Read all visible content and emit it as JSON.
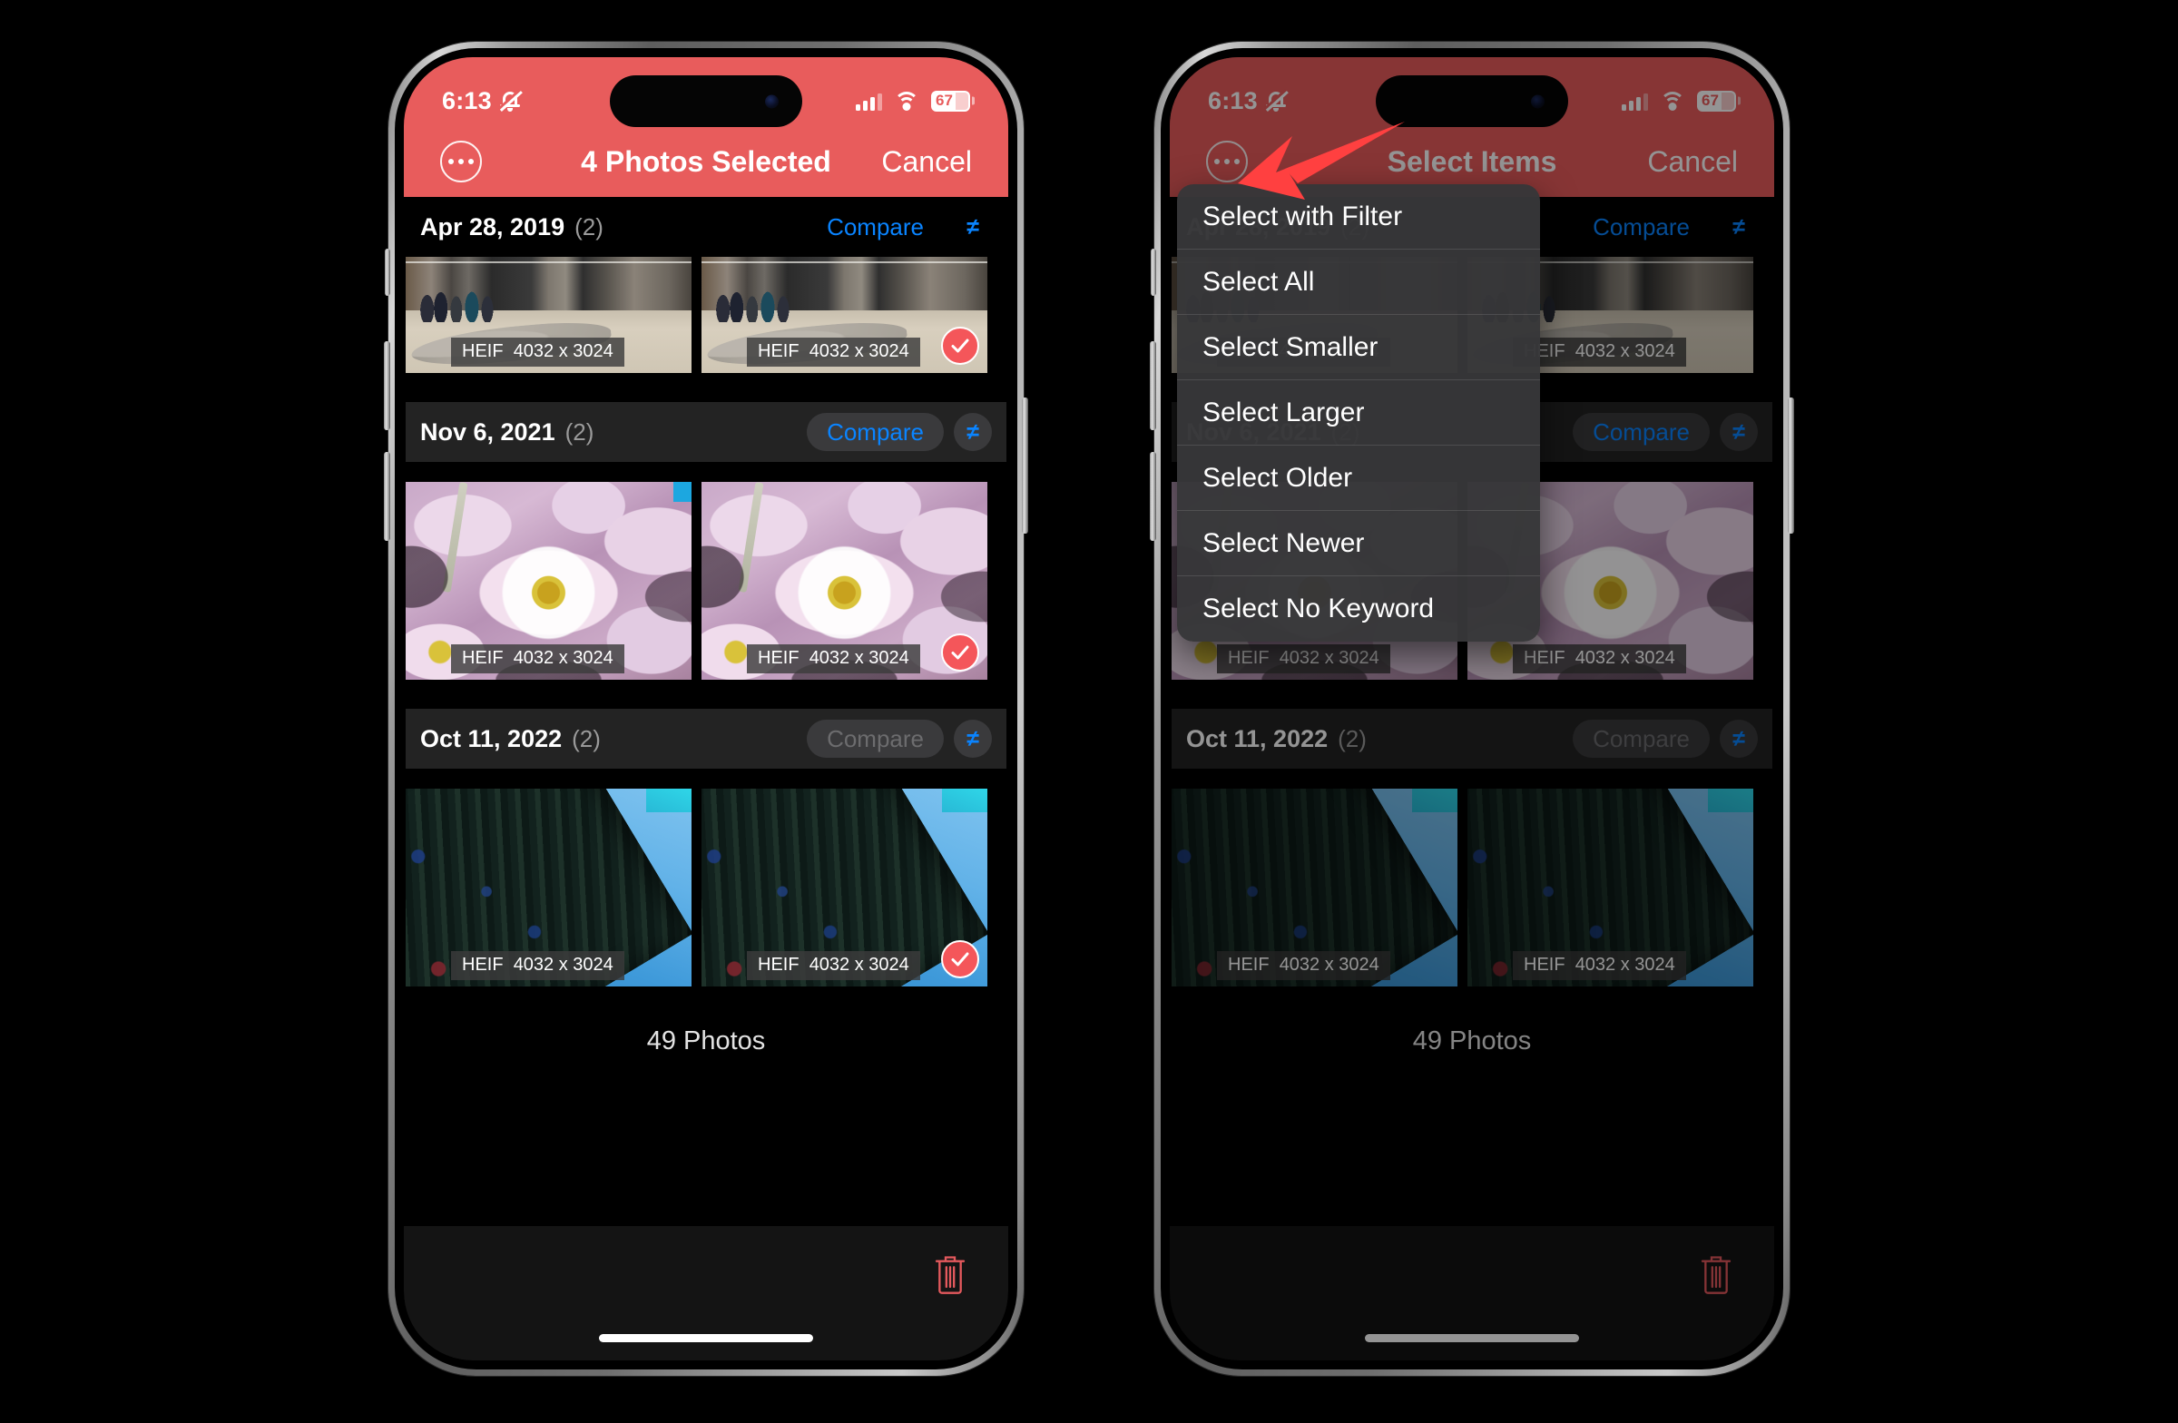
{
  "app": {
    "status_bar": {
      "time": "6:13",
      "silent_icon": "bell-slash-icon",
      "cellular_icon": "cellular-signal-icon",
      "wifi_icon": "wifi-icon",
      "battery_level": "67"
    },
    "accent_color": "#e85c5c",
    "link_color": "#0a84ff",
    "selection_color": "#ff6b6b",
    "delete_color": "#e4595d"
  },
  "phone_left": {
    "nav": {
      "more_icon": "ellipsis-icon",
      "title": "4 Photos Selected",
      "cancel_label": "Cancel"
    },
    "groups": [
      {
        "date": "Apr 28, 2019",
        "count": "(2)",
        "compare_label": "Compare",
        "not_equal_label": "≠",
        "compare_enabled": true,
        "photos": [
          {
            "format": "HEIF",
            "dimensions": "4032 x 3024",
            "selected": false,
            "art": "street"
          },
          {
            "format": "HEIF",
            "dimensions": "4032 x 3024",
            "selected": true,
            "art": "street"
          }
        ]
      },
      {
        "date": "Nov 6, 2021",
        "count": "(2)",
        "compare_label": "Compare",
        "not_equal_label": "≠",
        "compare_enabled": true,
        "photos": [
          {
            "format": "HEIF",
            "dimensions": "4032 x 3024",
            "selected": false,
            "art": "flower"
          },
          {
            "format": "HEIF",
            "dimensions": "4032 x 3024",
            "selected": true,
            "art": "flower"
          }
        ]
      },
      {
        "date": "Oct 11, 2022",
        "count": "(2)",
        "compare_label": "Compare",
        "not_equal_label": "≠",
        "compare_enabled": false,
        "photos": [
          {
            "format": "HEIF",
            "dimensions": "4032 x 3024",
            "selected": false,
            "art": "tower"
          },
          {
            "format": "HEIF",
            "dimensions": "4032 x 3024",
            "selected": true,
            "art": "tower"
          }
        ]
      }
    ],
    "footer": {
      "photo_count": "49 Photos",
      "delete_icon": "trash-icon"
    }
  },
  "phone_right": {
    "nav": {
      "more_icon": "ellipsis-icon",
      "title": "Select Items",
      "cancel_label": "Cancel"
    },
    "menu": {
      "items": [
        {
          "label": "Select with Filter"
        },
        {
          "label": "Select All"
        },
        {
          "label": "Select Smaller"
        },
        {
          "label": "Select Larger"
        },
        {
          "label": "Select Older"
        },
        {
          "label": "Select Newer"
        },
        {
          "label": "Select No Keyword"
        }
      ]
    },
    "groups": [
      {
        "date": "Apr 28, 2019",
        "count": "(2)",
        "compare_label": "Compare",
        "not_equal_label": "≠",
        "compare_enabled": true,
        "photos": [
          {
            "format": "HEIF",
            "dimensions": "4032 x 3024",
            "selected": false,
            "art": "street"
          },
          {
            "format": "HEIF",
            "dimensions": "4032 x 3024",
            "selected": false,
            "art": "street"
          }
        ]
      },
      {
        "date": "Nov 6, 2021",
        "count": "(2)",
        "compare_label": "Compare",
        "not_equal_label": "≠",
        "compare_enabled": true,
        "photos": [
          {
            "format": "HEIF",
            "dimensions": "4032 x 3024",
            "selected": false,
            "art": "flower"
          },
          {
            "format": "HEIF",
            "dimensions": "4032 x 3024",
            "selected": false,
            "art": "flower"
          }
        ]
      },
      {
        "date": "Oct 11, 2022",
        "count": "(2)",
        "compare_label": "Compare",
        "not_equal_label": "≠",
        "compare_enabled": false,
        "photos": [
          {
            "format": "HEIF",
            "dimensions": "4032 x 3024",
            "selected": false,
            "art": "tower"
          },
          {
            "format": "HEIF",
            "dimensions": "4032 x 3024",
            "selected": false,
            "art": "tower"
          }
        ]
      }
    ],
    "footer": {
      "photo_count": "49 Photos",
      "delete_icon": "trash-icon"
    }
  },
  "annotation": {
    "arrow_icon": "red-arrow-pointing-to-more-button",
    "arrow_color": "#ff4040"
  }
}
